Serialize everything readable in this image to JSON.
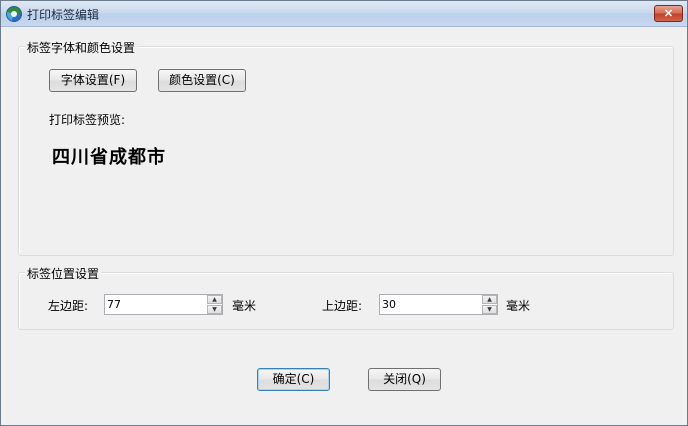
{
  "window": {
    "title": "打印标签编辑",
    "close_label": "✕"
  },
  "style_group": {
    "legend": "标签字体和颜色设置",
    "font_button": "字体设置(F)",
    "color_button": "颜色设置(C)",
    "preview_label": "打印标签预览:",
    "preview_text": "四川省成都市"
  },
  "position_group": {
    "legend": "标签位置设置",
    "left_label": "左边距:",
    "left_value": "77",
    "left_unit": "毫米",
    "top_label": "上边距:",
    "top_value": "30",
    "top_unit": "毫米"
  },
  "footer": {
    "ok_button": "确定(C)",
    "close_button": "关闭(Q)"
  },
  "icons": {
    "spin_up": "▲",
    "spin_down": "▼"
  }
}
